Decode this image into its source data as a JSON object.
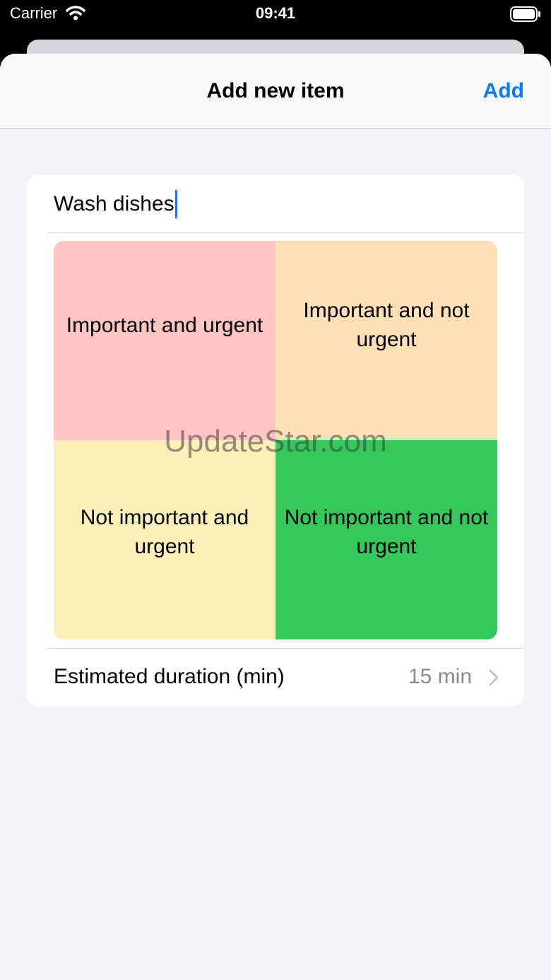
{
  "status_bar": {
    "carrier": "Carrier",
    "time": "09:41"
  },
  "nav": {
    "title": "Add new item",
    "add_label": "Add"
  },
  "form": {
    "title_value": "Wash dishes",
    "quadrants": [
      {
        "label": "Important and urgent",
        "color": "#ffc5c3"
      },
      {
        "label": "Important and not urgent",
        "color": "#fde0b5"
      },
      {
        "label": "Not important and urgent",
        "color": "#fcefb9"
      },
      {
        "label": "Not important and not urgent",
        "color": "#35c75a"
      }
    ],
    "duration_label": "Estimated duration (min)",
    "duration_value": "15 min"
  },
  "watermark": "UpdateStar.com",
  "colors": {
    "accent": "#0a7aff",
    "secondary_text": "#8a8a8e",
    "background": "#f2f2f7"
  },
  "icons": {
    "wifi": "wifi-icon",
    "battery": "battery-icon",
    "chevron": "chevron-right-icon"
  }
}
